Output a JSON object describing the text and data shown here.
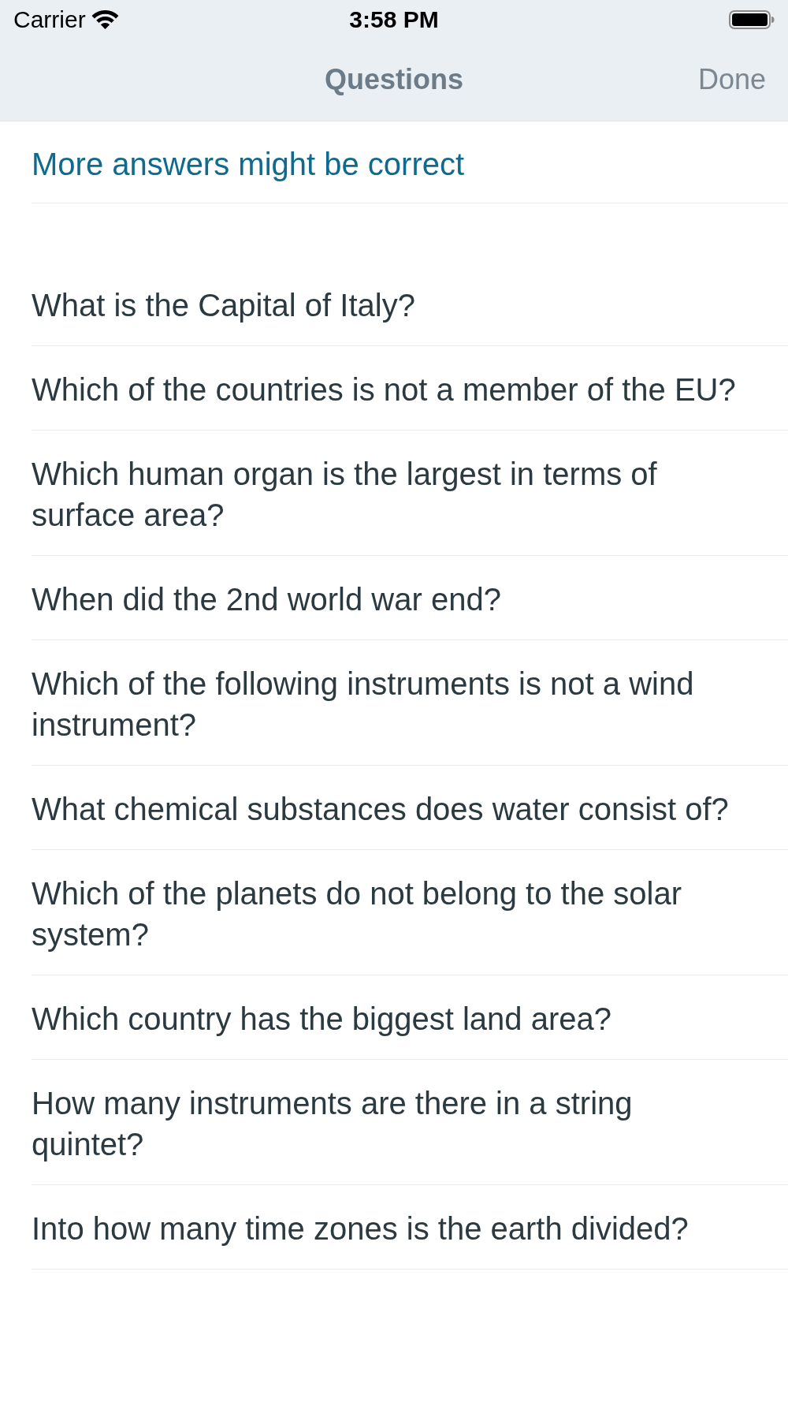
{
  "status_bar": {
    "carrier": "Carrier",
    "time": "3:58 PM"
  },
  "nav_bar": {
    "title": "Questions",
    "done_button": "Done"
  },
  "hint": "More answers might be correct",
  "questions": [
    "What is the Capital of Italy?",
    "Which of the countries is not a member of the EU?",
    "Which human organ is the largest in terms of surface area?",
    "When did the 2nd world war end?",
    "Which of the following instruments is not a wind instrument?",
    "What chemical substances does water consist of?",
    "Which of the planets do not belong to the solar system?",
    "Which country has the biggest land area?",
    "How many instruments are there in a string quintet?",
    "Into how many time zones is the earth divided?"
  ]
}
